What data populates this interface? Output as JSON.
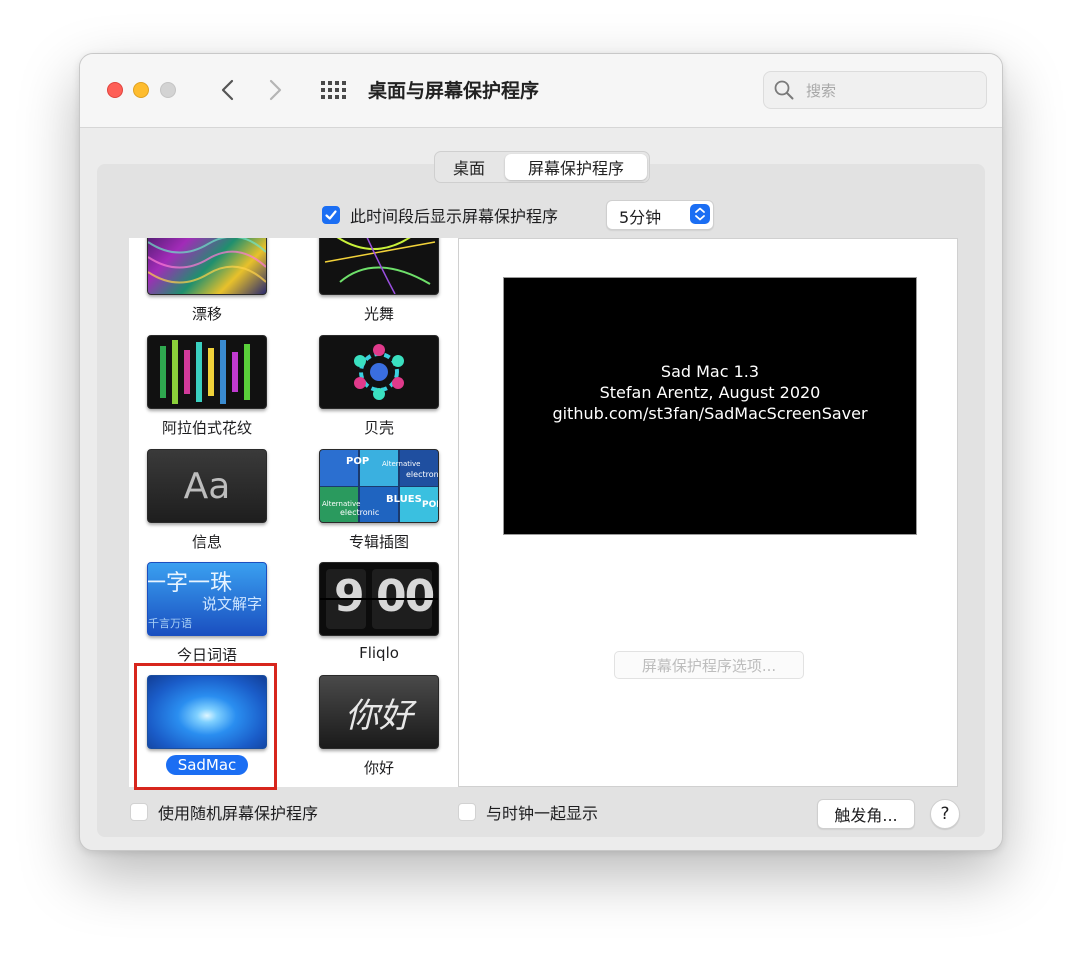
{
  "window": {
    "title": "桌面与屏幕保护程序"
  },
  "search": {
    "placeholder": "搜索"
  },
  "tabs": [
    {
      "label": "桌面"
    },
    {
      "label": "屏幕保护程序",
      "selected": true
    }
  ],
  "show_after": {
    "label": "此时间段后显示屏幕保护程序",
    "checked": true,
    "value": "5分钟"
  },
  "savers": [
    {
      "label": "漂移"
    },
    {
      "label": "光舞"
    },
    {
      "label": "阿拉伯式花纹"
    },
    {
      "label": "贝壳"
    },
    {
      "label": "信息",
      "thumb_text": "Aa"
    },
    {
      "label": "专辑插图"
    },
    {
      "label": "今日词语",
      "thumb_line1": "一字一珠",
      "thumb_line2": "说文解字",
      "thumb_line3": "千言万语"
    },
    {
      "label": "Fliqlo",
      "thumb_left": "9",
      "thumb_right": "00"
    },
    {
      "label": "SadMac",
      "selected": true
    },
    {
      "label": "你好",
      "thumb_text": "你好"
    }
  ],
  "album_words": [
    "POP",
    "Alternative",
    "electronic",
    "BLUES",
    "POP",
    "Alternative",
    "electronic"
  ],
  "preview": {
    "line1": "Sad Mac 1.3",
    "line2": "Stefan Arentz, August 2020",
    "line3": "github.com/st3fan/SadMacScreenSaver",
    "options_button": "屏幕保护程序选项..."
  },
  "footer": {
    "random_label": "使用随机屏幕保护程序",
    "random_checked": false,
    "clock_label": "与时钟一起显示",
    "clock_checked": false,
    "hot_corners": "触发角...",
    "help": "?"
  },
  "colors": {
    "accent": "#1b6ef3",
    "highlight_box": "#d7261d"
  }
}
